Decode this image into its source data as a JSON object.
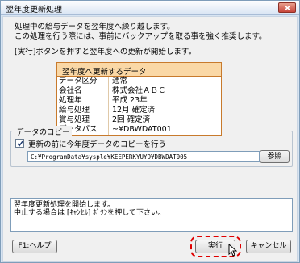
{
  "window": {
    "title": "翌年度更新処理"
  },
  "messages": {
    "line1": "処理中の給与データを翌年度へ繰り越します。",
    "line2": "この処理を行う際には、事前にバックアップを取る事を強く推奨します。",
    "line3": "[実行]ボタンを押すと翌年度への更新が開始します。"
  },
  "info": {
    "header": "翌年度へ更新するデータ",
    "rows": [
      {
        "key": "データ区分",
        "value": "通常"
      },
      {
        "key": "会社名",
        "value": "株式会社ＡＢＣ"
      },
      {
        "key": "処理年",
        "value": "平成 23年"
      },
      {
        "key": "給与処理",
        "value": "12月 確定済"
      },
      {
        "key": "賞与処理",
        "value": "2回 確定済"
      },
      {
        "key": "データパス",
        "value": "~¥DBWDAT001"
      }
    ]
  },
  "copy": {
    "legend": "データのコピー",
    "checkbox_label": "更新の前に今年度データのコピーを行う",
    "checked": true,
    "path": "C:¥ProgramData¥sysple¥KEEPERKYUYO¥DBWDAT005",
    "browse_label": "参照"
  },
  "log": {
    "line1": "翌年度更新処理を開始します。",
    "line2": "中止する場合は [ｷｬﾝｾﾙ] ﾎﾞﾀﾝを押して下さい。"
  },
  "buttons": {
    "help": "F1:ヘルプ",
    "execute": "実行",
    "cancel": "キャンセル"
  }
}
